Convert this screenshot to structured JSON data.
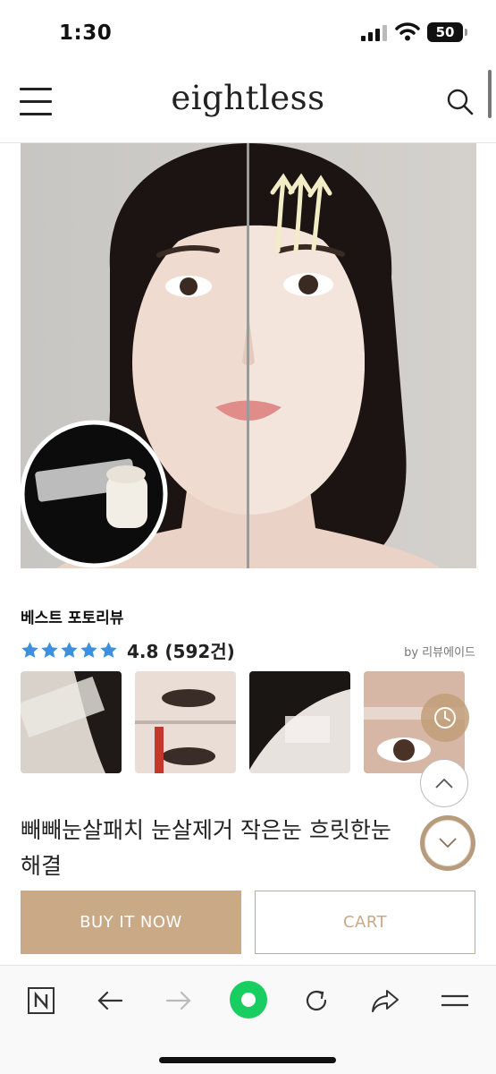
{
  "status_bar": {
    "time": "1:30",
    "battery": "50"
  },
  "header": {
    "brand": "eightless",
    "menu_icon": "menu-icon",
    "search_icon": "search-icon"
  },
  "reviews": {
    "title": "베스트 포토리뷰",
    "rating_text": "4.8 (592건)",
    "rating_value": 4.8,
    "stars_max": 5,
    "provider": "by 리뷰에이드",
    "star_color": "#3d8fe0"
  },
  "product": {
    "name": "빼빼눈살패치 눈살제거 작은눈 흐릿한눈 해결"
  },
  "actions": {
    "buy_label": "BUY IT NOW",
    "cart_label": "CART",
    "accent_color": "#caa987"
  },
  "floating": {
    "recent_icon": "clock-icon",
    "up_icon": "chevron-up-icon",
    "down_icon": "chevron-down-icon"
  },
  "browser_bar": {
    "icons": [
      "naver-n-icon",
      "back-arrow-icon",
      "forward-arrow-icon",
      "green-home-icon",
      "reload-icon",
      "share-icon",
      "menu-lines-icon"
    ]
  }
}
